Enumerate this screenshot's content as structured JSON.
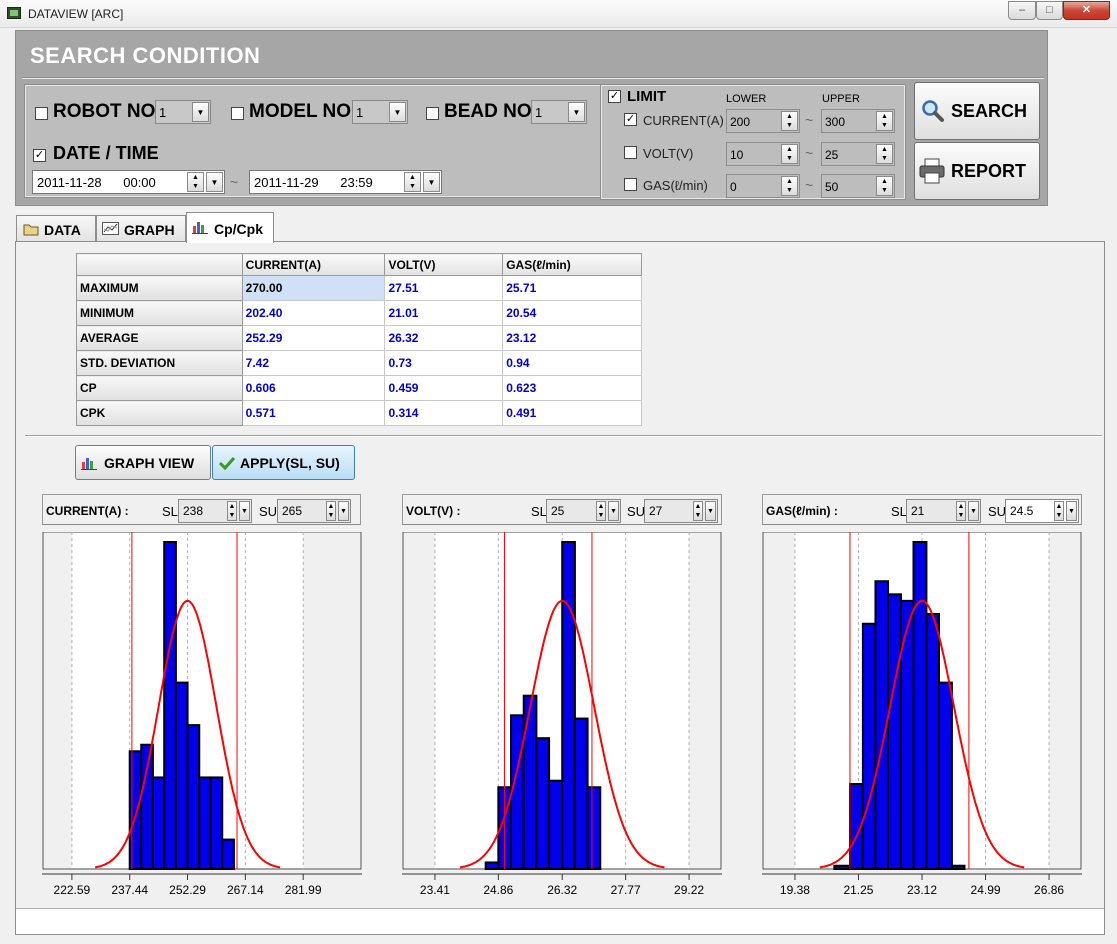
{
  "window": {
    "title": "DATAVIEW [ARC]",
    "min": "‒",
    "max": "□",
    "close": "✕"
  },
  "search": {
    "title": "SEARCH CONDITION",
    "robot": {
      "label": "ROBOT NO.",
      "value": "1",
      "checked": false
    },
    "model": {
      "label": "MODEL NO.",
      "value": "1",
      "checked": false
    },
    "bead": {
      "label": "BEAD NO.",
      "value": "1",
      "checked": false
    },
    "date": {
      "label": "DATE / TIME",
      "checked": true,
      "from": "2011-11-28      00:00",
      "to": "2011-11-29      23:59",
      "tilde": "~"
    },
    "limit": {
      "label": "LIMIT",
      "checked": true,
      "lower_label": "LOWER",
      "upper_label": "UPPER",
      "rows": [
        {
          "label": "CURRENT(A)",
          "checked": true,
          "lower": "200",
          "upper": "300"
        },
        {
          "label": "VOLT(V)",
          "checked": false,
          "lower": "10",
          "upper": "25"
        },
        {
          "label": "GAS(ℓ/min)",
          "checked": false,
          "lower": "0",
          "upper": "50"
        }
      ]
    },
    "search_button": "SEARCH",
    "report_button": "REPORT"
  },
  "tabs": [
    {
      "label": "DATA",
      "icon": "folder-icon"
    },
    {
      "label": "GRAPH",
      "icon": "line-chart-icon"
    },
    {
      "label": "Cp/Cpk",
      "icon": "bar-chart-icon",
      "active": true
    }
  ],
  "stats": {
    "columns": [
      "",
      "CURRENT(A)",
      "VOLT(V)",
      "GAS(ℓ/min)"
    ],
    "rows": [
      [
        "MAXIMUM",
        "270.00",
        "27.51",
        "25.71"
      ],
      [
        "MINIMUM",
        "202.40",
        "21.01",
        "20.54"
      ],
      [
        "AVERAGE",
        "252.29",
        "26.32",
        "23.12"
      ],
      [
        "STD. DEVIATION",
        "7.42",
        "0.73",
        "0.94"
      ],
      [
        "CP",
        "0.606",
        "0.459",
        "0.623"
      ],
      [
        "CPK",
        "0.571",
        "0.314",
        "0.491"
      ]
    ]
  },
  "buttons": {
    "graph_view": "GRAPH VIEW",
    "apply": "APPLY(SL, SU)"
  },
  "charts_header": [
    {
      "name": "CURRENT(A) :",
      "sl_label": "SL",
      "sl": "238",
      "su_label": "SU",
      "su": "265"
    },
    {
      "name": "VOLT(V) :",
      "sl_label": "SL",
      "sl": "25",
      "su_label": "SU",
      "su": "27"
    },
    {
      "name": "GAS(ℓ/min) :",
      "sl_label": "SL",
      "sl": "21",
      "su_label": "SU",
      "su": "24.5"
    }
  ],
  "chart_data": [
    {
      "type": "bar",
      "title": "CURRENT(A)",
      "x_ticks": [
        "222.59",
        "237.44",
        "252.29",
        "267.14",
        "281.99"
      ],
      "xlim": [
        215.17,
        296.84
      ],
      "bin_edges": [
        237.44,
        240.4,
        243.4,
        246.3,
        249.3,
        252.3,
        255.3,
        258.2,
        261.2,
        264.2,
        267.1
      ],
      "values": [
        36,
        38,
        28,
        100,
        57,
        44,
        28,
        28,
        9,
        0
      ],
      "normal_curve": {
        "mean": 252.29,
        "sd": 7.42,
        "peak": 82
      },
      "spec_limits": {
        "sl": 238,
        "su": 265
      },
      "bar_color": "#0000ee",
      "curve_color": "#ff0000",
      "grid": true
    },
    {
      "type": "bar",
      "title": "VOLT(V)",
      "x_ticks": [
        "23.41",
        "24.86",
        "26.32",
        "27.77",
        "29.22"
      ],
      "xlim": [
        22.68,
        29.95
      ],
      "bin_edges": [
        24.57,
        24.86,
        25.15,
        25.44,
        25.73,
        26.02,
        26.32,
        26.61,
        26.9,
        27.19
      ],
      "values": [
        2,
        25,
        47,
        53,
        40,
        27,
        100,
        46,
        25
      ],
      "normal_curve": {
        "mean": 26.32,
        "sd": 0.73,
        "peak": 82
      },
      "spec_limits": {
        "sl": 25,
        "su": 27
      },
      "bar_color": "#0000ee",
      "curve_color": "#ff0000",
      "grid": true
    },
    {
      "type": "bar",
      "title": "GAS(ℓ/min)",
      "x_ticks": [
        "19.38",
        "21.25",
        "23.12",
        "24.99",
        "26.86"
      ],
      "xlim": [
        18.44,
        27.8
      ],
      "bin_edges": [
        20.54,
        21.0,
        21.38,
        21.75,
        22.12,
        22.5,
        22.87,
        23.25,
        23.62,
        24.0,
        24.37,
        24.75,
        25.12
      ],
      "values": [
        1,
        26,
        75,
        88,
        84,
        82,
        100,
        78,
        57,
        1,
        0,
        0
      ],
      "normal_curve": {
        "mean": 23.12,
        "sd": 0.94,
        "peak": 82
      },
      "spec_limits": {
        "sl": 21,
        "su": 24.5
      },
      "bar_color": "#0000ee",
      "curve_color": "#ff0000",
      "grid": true
    }
  ]
}
